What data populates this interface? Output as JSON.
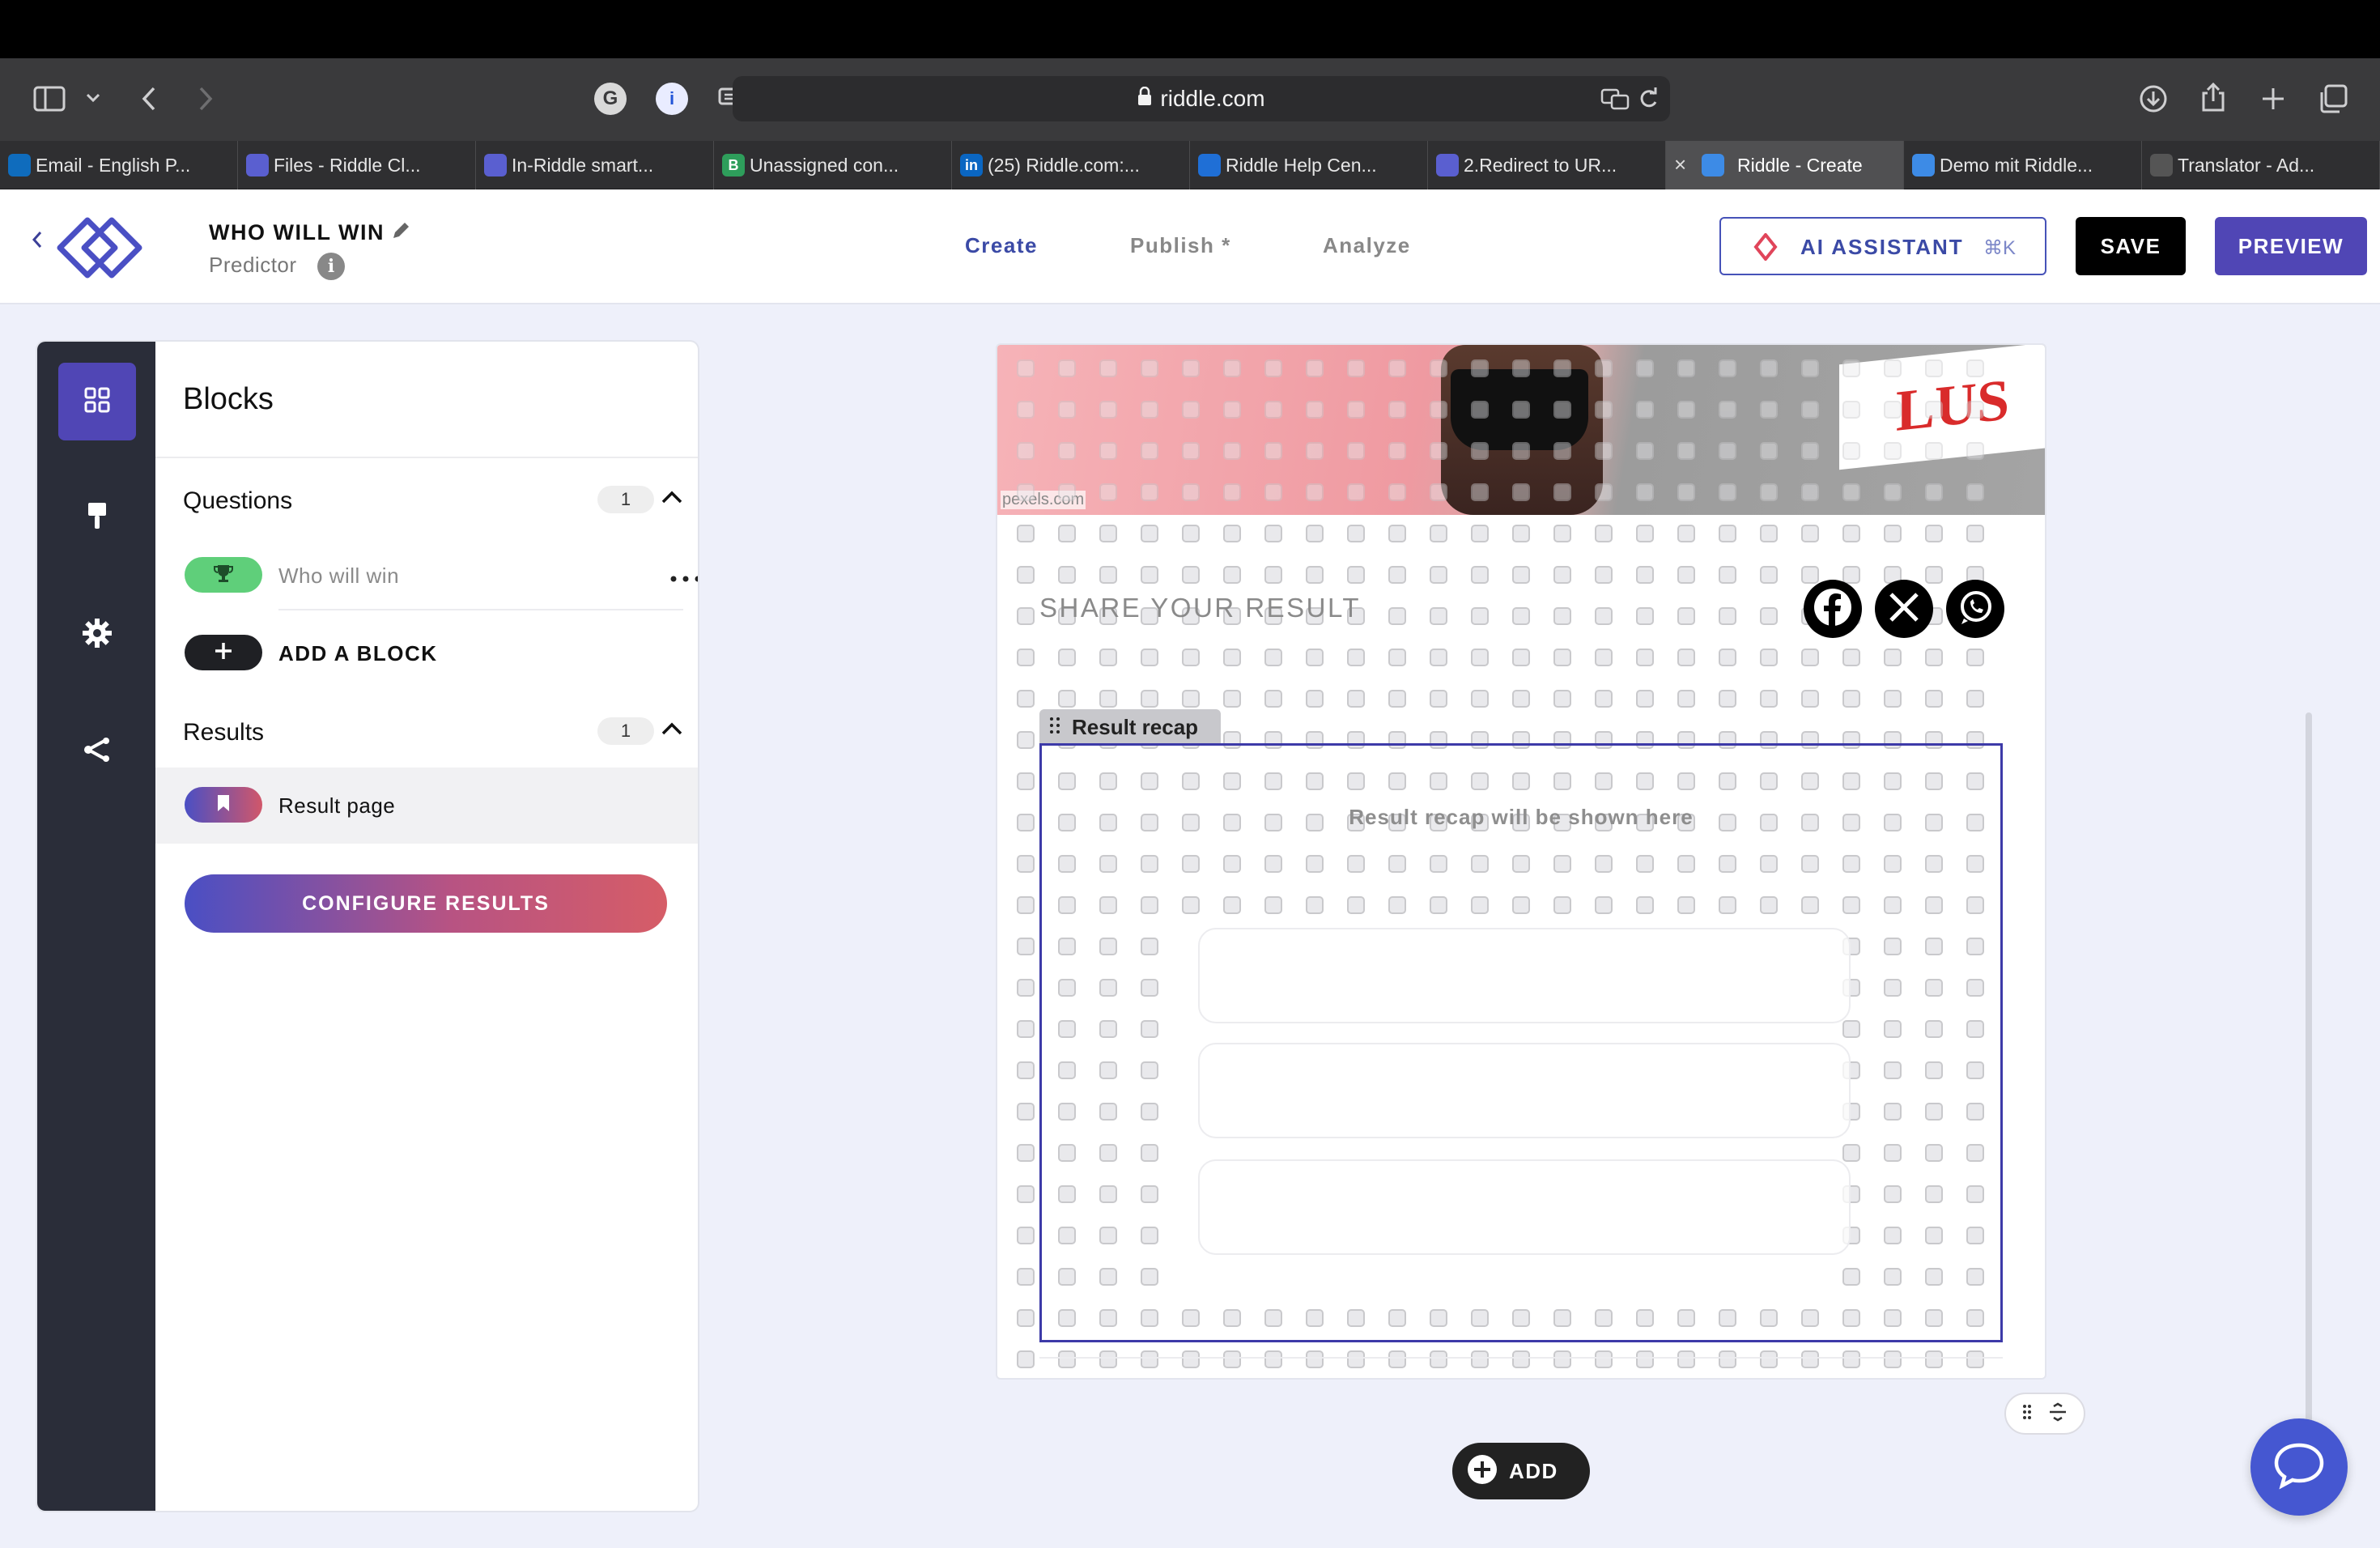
{
  "browser": {
    "url": "riddle.com",
    "tabs": [
      {
        "label": "Email - English P...",
        "fav": "outlook",
        "color": "#0f6cbd"
      },
      {
        "label": "Files - Riddle Cl...",
        "fav": "riddle",
        "color": "#5a5fd0"
      },
      {
        "label": "In-Riddle smart...",
        "fav": "riddle",
        "color": "#5a5fd0"
      },
      {
        "label": "Unassigned con...",
        "fav": "B",
        "color": "#2e9e5b"
      },
      {
        "label": "(25) Riddle.com:...",
        "fav": "in",
        "color": "#0a66c2"
      },
      {
        "label": "Riddle Help Cen...",
        "fav": "trello",
        "color": "#1f6fd6"
      },
      {
        "label": "2.Redirect to UR...",
        "fav": "riddle",
        "color": "#5a5fd0"
      },
      {
        "label": "Riddle - Create",
        "fav": "riddle-blue",
        "color": "#3d8be6",
        "active": true
      },
      {
        "label": "Demo mit Riddle...",
        "fav": "riddle-blue",
        "color": "#3d8be6"
      },
      {
        "label": "Translator - Ad...",
        "fav": "diamond",
        "color": "#555"
      }
    ]
  },
  "header": {
    "title": "WHO WILL WIN",
    "subtitle": "Predictor",
    "nav": {
      "create": "Create",
      "publish": "Publish *",
      "analyze": "Analyze"
    },
    "ai_label": "AI ASSISTANT",
    "ai_shortcut": "⌘K",
    "save_label": "SAVE",
    "preview_label": "PREVIEW",
    "accent": "#5046b5"
  },
  "sidebar": {
    "title": "Blocks",
    "questions_label": "Questions",
    "questions_count": "1",
    "question_item": "Who will win",
    "add_block_label": "ADD A BLOCK",
    "results_label": "Results",
    "results_count": "1",
    "result_item": "Result page",
    "configure_label": "CONFIGURE RESULTS"
  },
  "canvas": {
    "image_credit": "pexels.com",
    "share_label": "SHARE YOUR RESULT",
    "recap_tag": "Result recap",
    "recap_placeholder": "Result recap will be shown here",
    "banner_text": "LUS",
    "add_label": "ADD"
  }
}
